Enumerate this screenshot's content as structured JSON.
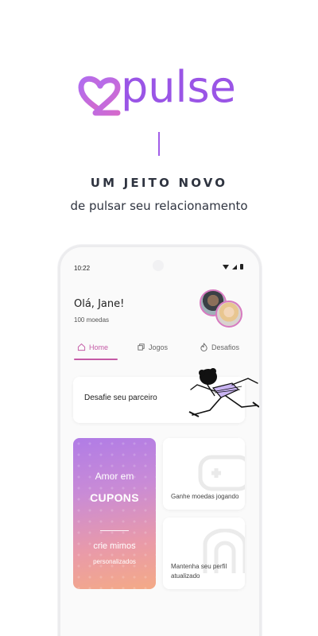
{
  "brand": {
    "logo_text": "pulse"
  },
  "tagline": {
    "line1": "UM JEITO NOVO",
    "line2": "de pulsar seu relacionamento"
  },
  "phone": {
    "status": {
      "time": "10:22"
    },
    "header": {
      "greeting": "Olá, Jane!",
      "coins": "100 moedas"
    },
    "tabs": [
      {
        "label": "Home",
        "icon": "home-icon",
        "active": true
      },
      {
        "label": "Jogos",
        "icon": "games-icon",
        "active": false
      },
      {
        "label": "Desafios",
        "icon": "fire-icon",
        "active": false
      }
    ],
    "challenge_card": {
      "label": "Desafie seu parceiro"
    },
    "promo_card": {
      "line1": "Amor em",
      "line2": "CUPONS",
      "line3": "crie mimos",
      "line4": "personalizados"
    },
    "mini_cards": [
      {
        "label": "Ganhe moedas jogando"
      },
      {
        "label": "Mantenha seu perfil atualizado"
      }
    ]
  },
  "colors": {
    "accent": "#9a55e6",
    "accent_pink": "#c45aa6"
  }
}
